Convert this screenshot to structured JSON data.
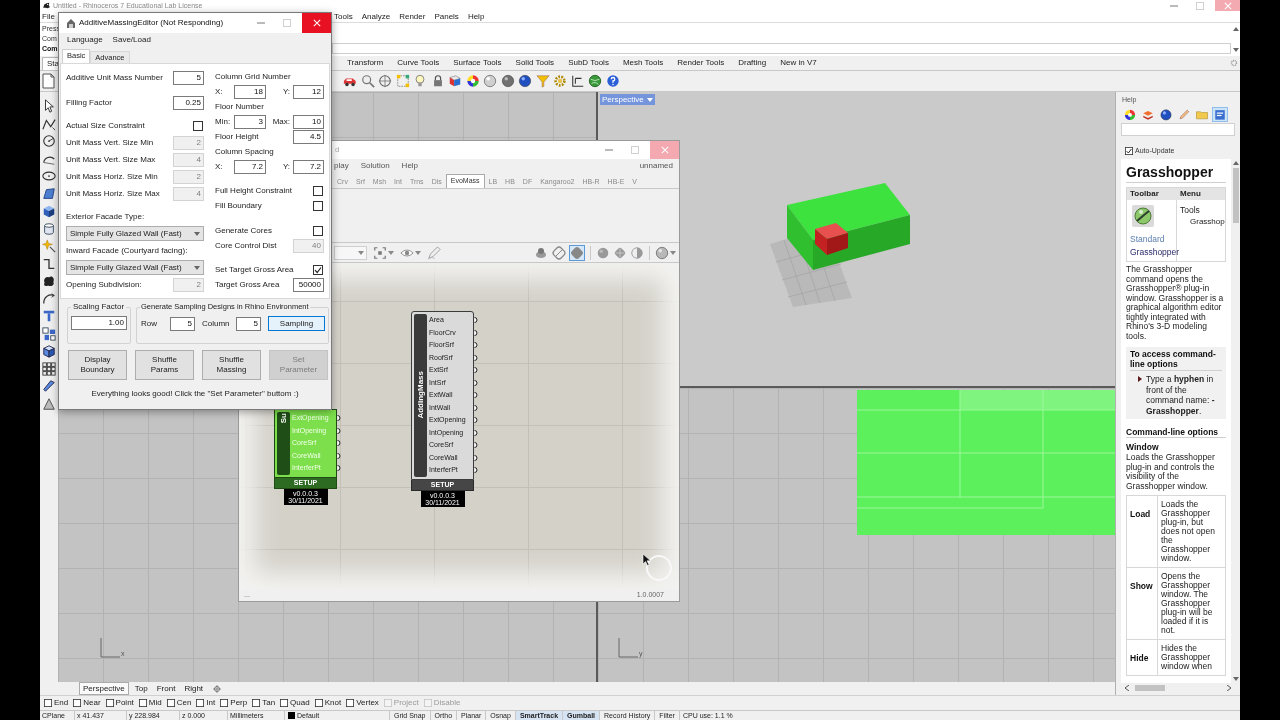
{
  "rhino_window": {
    "title": "Untitled - Rhinoceros 7 Educational Lab License",
    "menu": [
      "File",
      "Tools",
      "Analyze",
      "Render",
      "Panels",
      "Help"
    ],
    "command_history": [
      {
        "text": "Press",
        "bold": false
      },
      {
        "text": "Com",
        "bold": false
      },
      {
        "text": "Com",
        "bold": true
      }
    ],
    "toolbar_tabs": [
      {
        "label": "Sta",
        "selected": true
      },
      {
        "label": "Transform",
        "selected": false
      },
      {
        "label": "Curve Tools",
        "selected": false
      },
      {
        "label": "Surface Tools",
        "selected": false
      },
      {
        "label": "Solid Tools",
        "selected": false
      },
      {
        "label": "SubD Tools",
        "selected": false
      },
      {
        "label": "Mesh Tools",
        "selected": false
      },
      {
        "label": "Render Tools",
        "selected": false
      },
      {
        "label": "Drafting",
        "selected": false
      },
      {
        "label": "New in V7",
        "selected": false
      }
    ]
  },
  "massing_editor": {
    "title": "AdditiveMassingEditor (Not Responding)",
    "menu": [
      "Language",
      "Save/Load"
    ],
    "tabs": [
      {
        "label": "Basic",
        "selected": true
      },
      {
        "label": "Advance",
        "selected": false
      }
    ],
    "left_sections": [
      [
        {
          "kind": "number",
          "label": "Additive Unit Mass Number",
          "value": "5",
          "disabled": false
        },
        {
          "kind": "number",
          "label": "Filling Factor",
          "value": "0.25",
          "disabled": false
        }
      ],
      [
        {
          "kind": "checkbox",
          "label": "Actual Size Constraint",
          "checked": false
        },
        {
          "kind": "number",
          "label": "Unit Mass Vert. Size Min",
          "value": "2",
          "disabled": true
        },
        {
          "kind": "number",
          "label": "Unit Mass Vert. Size Max",
          "value": "4",
          "disabled": true
        },
        {
          "kind": "number",
          "label": "Unit Mass Horiz. Size Min",
          "value": "2",
          "disabled": true
        },
        {
          "kind": "number",
          "label": "Unit Mass Horiz. Size Max",
          "value": "4",
          "disabled": true
        }
      ],
      [
        {
          "kind": "heading",
          "label": "Exterior Facade Type:"
        },
        {
          "kind": "dropdown",
          "value": "Simple Fully Glazed Wall (Fast)"
        },
        {
          "kind": "heading",
          "label": "Inward Facade (Courtyard facing):"
        },
        {
          "kind": "dropdown",
          "value": "Simple Fully Glazed Wall (Fast)"
        },
        {
          "kind": "number",
          "label": "Opening Subdivision:",
          "value": "2",
          "disabled": true
        }
      ]
    ],
    "right_sections": [
      [
        {
          "kind": "heading",
          "label": "Column Grid Number"
        },
        {
          "kind": "pair",
          "fields": [
            {
              "label": "X:",
              "value": "18"
            },
            {
              "label": "Y:",
              "value": "12"
            }
          ]
        },
        {
          "kind": "heading",
          "label": "Floor Number"
        },
        {
          "kind": "pair",
          "fields": [
            {
              "label": "Min:",
              "value": "3"
            },
            {
              "label": "Max:",
              "value": "10"
            }
          ]
        },
        {
          "kind": "number",
          "label": "Floor Height",
          "value": "4.5",
          "disabled": false
        },
        {
          "kind": "heading",
          "label": "Column Spacing"
        },
        {
          "kind": "pair",
          "fields": [
            {
              "label": "X:",
              "value": "7.2"
            },
            {
              "label": "Y:",
              "value": "7.2"
            }
          ]
        }
      ],
      [
        {
          "kind": "checkbox",
          "label": "Full Height Constraint",
          "checked": false
        },
        {
          "kind": "checkbox",
          "label": "Fill Boundary",
          "checked": false
        }
      ],
      [
        {
          "kind": "checkbox",
          "label": "Generate Cores",
          "checked": false
        },
        {
          "kind": "number",
          "label": "Core Control Dist",
          "value": "40",
          "disabled": true
        }
      ],
      [
        {
          "kind": "checkbox",
          "label": "Set Target Gross Area",
          "checked": true
        },
        {
          "kind": "number",
          "label": "Target Gross Area",
          "value": "50000",
          "disabled": false
        }
      ]
    ],
    "scaling": {
      "title": "Scaling Factor",
      "value": "1.00"
    },
    "sampling": {
      "title": "Generate Sampling Designs in Rhino Environment",
      "row_label": "Row",
      "row_value": "5",
      "column_label": "Column",
      "column_value": "5",
      "button": "Sampling"
    },
    "buttons": [
      {
        "label": "Display Boundary",
        "disabled": false
      },
      {
        "label": "Shuffle Params",
        "disabled": false
      },
      {
        "label": "Shuffle Massing",
        "disabled": false
      },
      {
        "label": "Set Parameter",
        "disabled": true
      }
    ],
    "message": "Everything looks good! Click the \"Set Parameter\" buttom :)"
  },
  "grasshopper": {
    "title": "d",
    "menu": [
      "play",
      "Solution",
      "Help"
    ],
    "document": "unnamed",
    "tabs": [
      {
        "label": "Crv",
        "selected": false
      },
      {
        "label": "Srf",
        "selected": false
      },
      {
        "label": "Msh",
        "selected": false
      },
      {
        "label": "Int",
        "selected": false
      },
      {
        "label": "Trns",
        "selected": false
      },
      {
        "label": "Dis",
        "selected": false
      },
      {
        "label": "EvoMass",
        "selected": true
      },
      {
        "label": "LB",
        "selected": false
      },
      {
        "label": "HB",
        "selected": false
      },
      {
        "label": "DF",
        "selected": false
      },
      {
        "label": "Kangaroo2",
        "selected": false
      },
      {
        "label": "HB-R",
        "selected": false
      },
      {
        "label": "HB-E",
        "selected": false
      },
      {
        "label": "V",
        "selected": false
      }
    ],
    "preview_modes": [
      {
        "selected": false
      },
      {
        "selected": false
      },
      {
        "selected": true
      }
    ],
    "components": [
      {
        "name": "Su",
        "selected": true,
        "outputs": [
          "ExtOpening",
          "IntOpening",
          "CoreSrf",
          "CoreWall",
          "InterferPt"
        ],
        "footer": "SETUP",
        "version": "v0.0.0.3",
        "date": "30/11/2021"
      },
      {
        "name": "AddingMass",
        "selected": false,
        "outputs": [
          "Area",
          "FloorCrv",
          "FloorSrf",
          "RoofSrf",
          "ExtSrf",
          "IntSrf",
          "ExtWall",
          "IntWall",
          "ExtOpening",
          "IntOpening",
          "CoreSrf",
          "CoreWall",
          "InterferPt"
        ],
        "footer": "SETUP",
        "version": "v0.0.0.3",
        "date": "30/11/2021"
      }
    ],
    "status": "...",
    "version": "1.0.0007"
  },
  "viewports": {
    "perspective": {
      "label": "Perspective",
      "active": true
    },
    "bottom_left": {
      "axis_label": "x"
    },
    "bottom_right": {
      "axis_label": "y"
    }
  },
  "viewport_tabs": [
    {
      "label": "Perspective",
      "selected": true
    },
    {
      "label": "Top",
      "selected": false
    },
    {
      "label": "Front",
      "selected": false
    },
    {
      "label": "Right",
      "selected": false
    }
  ],
  "help_panel": {
    "title": "Help",
    "panel_tabs": [
      {
        "selected": false
      },
      {
        "selected": false
      },
      {
        "selected": false
      },
      {
        "selected": false
      },
      {
        "selected": false
      },
      {
        "selected": true
      }
    ],
    "auto_update": {
      "label": "Auto-Update",
      "checked": true
    },
    "heading": "Grasshopper",
    "table_columns": [
      "Toolbar",
      "Menu"
    ],
    "toolbar_links": [
      {
        "label": "Standard",
        "visited": false
      },
      {
        "label": "Grasshopper",
        "visited": true
      }
    ],
    "menu_path": [
      "Tools",
      "Grasshop"
    ],
    "description": "The Grasshopper command opens the Grasshopper® plug-in window. Grasshopper is a graphical algorithm editor tightly integrated with Rhino's 3-D modeling tools.",
    "note": {
      "title": "To access command-line options",
      "text": "Type a **hyphen** in front of the command name: **-Grasshopper**."
    },
    "section_title": "Command-line options",
    "subsection_title": "Window",
    "subsection_text": "Loads the Grasshopper plug-in and controls the visibility of the Grasshopper window.",
    "options": [
      {
        "name": "Load",
        "description": "Loads the Grasshopper plug-in, but does not open the Grasshopper window."
      },
      {
        "name": "Show",
        "description": "Opens the Grasshopper window. The Grasshopper plug-in will be loaded if it is not."
      },
      {
        "name": "Hide",
        "description": "Hides the Grasshopper window when"
      }
    ]
  },
  "osnaps": [
    {
      "label": "End",
      "checked": false,
      "disabled": false
    },
    {
      "label": "Near",
      "checked": false,
      "disabled": false
    },
    {
      "label": "Point",
      "checked": false,
      "disabled": false
    },
    {
      "label": "Mid",
      "checked": false,
      "disabled": false
    },
    {
      "label": "Cen",
      "checked": false,
      "disabled": false
    },
    {
      "label": "Int",
      "checked": false,
      "disabled": false
    },
    {
      "label": "Perp",
      "checked": false,
      "disabled": false
    },
    {
      "label": "Tan",
      "checked": false,
      "disabled": false
    },
    {
      "label": "Quad",
      "checked": false,
      "disabled": false
    },
    {
      "label": "Knot",
      "checked": false,
      "disabled": false
    },
    {
      "label": "Vertex",
      "checked": false,
      "disabled": false
    },
    {
      "label": "Project",
      "checked": false,
      "disabled": true
    },
    {
      "label": "Disable",
      "checked": false,
      "disabled": true
    }
  ],
  "status_bar": {
    "fields": [
      "CPlane",
      "x 41.437",
      "y 228.984",
      "z 0.000",
      "Millimeters"
    ],
    "layer": "Default",
    "toggles": [
      {
        "label": "Grid Snap",
        "on": false
      },
      {
        "label": "Ortho",
        "on": false
      },
      {
        "label": "Planar",
        "on": false
      },
      {
        "label": "Osnap",
        "on": false
      },
      {
        "label": "SmartTrack",
        "on": true
      },
      {
        "label": "Gumball",
        "on": true
      },
      {
        "label": "Record History",
        "on": false
      },
      {
        "label": "Filter",
        "on": false
      }
    ],
    "cpu": "CPU use: 1.1 %"
  }
}
